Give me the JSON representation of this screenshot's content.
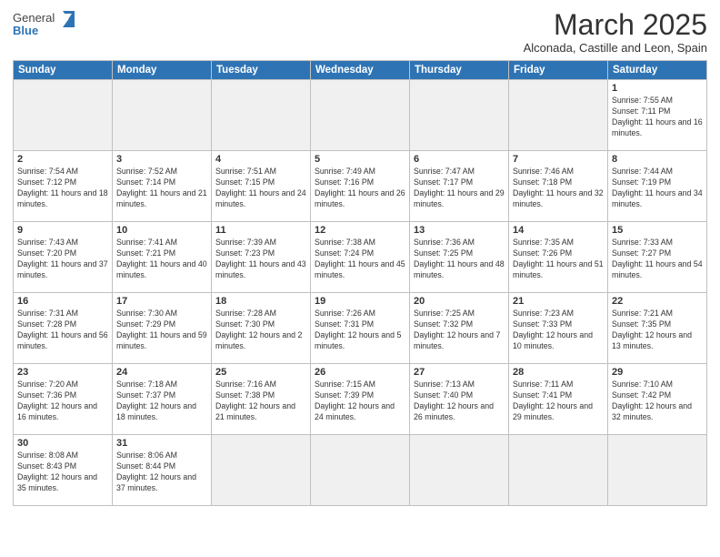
{
  "header": {
    "logo_general": "General",
    "logo_blue": "Blue",
    "month_title": "March 2025",
    "location": "Alconada, Castille and Leon, Spain"
  },
  "days_of_week": [
    "Sunday",
    "Monday",
    "Tuesday",
    "Wednesday",
    "Thursday",
    "Friday",
    "Saturday"
  ],
  "weeks": [
    [
      {
        "day": "",
        "empty": true
      },
      {
        "day": "",
        "empty": true
      },
      {
        "day": "",
        "empty": true
      },
      {
        "day": "",
        "empty": true
      },
      {
        "day": "",
        "empty": true
      },
      {
        "day": "",
        "empty": true
      },
      {
        "day": "1",
        "sunrise": "7:55 AM",
        "sunset": "7:11 PM",
        "daylight": "11 hours and 16 minutes."
      }
    ],
    [
      {
        "day": "2",
        "sunrise": "7:54 AM",
        "sunset": "7:12 PM",
        "daylight": "11 hours and 18 minutes."
      },
      {
        "day": "3",
        "sunrise": "7:52 AM",
        "sunset": "7:14 PM",
        "daylight": "11 hours and 21 minutes."
      },
      {
        "day": "4",
        "sunrise": "7:51 AM",
        "sunset": "7:15 PM",
        "daylight": "11 hours and 24 minutes."
      },
      {
        "day": "5",
        "sunrise": "7:49 AM",
        "sunset": "7:16 PM",
        "daylight": "11 hours and 26 minutes."
      },
      {
        "day": "6",
        "sunrise": "7:47 AM",
        "sunset": "7:17 PM",
        "daylight": "11 hours and 29 minutes."
      },
      {
        "day": "7",
        "sunrise": "7:46 AM",
        "sunset": "7:18 PM",
        "daylight": "11 hours and 32 minutes."
      },
      {
        "day": "8",
        "sunrise": "7:44 AM",
        "sunset": "7:19 PM",
        "daylight": "11 hours and 34 minutes."
      }
    ],
    [
      {
        "day": "9",
        "sunrise": "7:43 AM",
        "sunset": "7:20 PM",
        "daylight": "11 hours and 37 minutes."
      },
      {
        "day": "10",
        "sunrise": "7:41 AM",
        "sunset": "7:21 PM",
        "daylight": "11 hours and 40 minutes."
      },
      {
        "day": "11",
        "sunrise": "7:39 AM",
        "sunset": "7:23 PM",
        "daylight": "11 hours and 43 minutes."
      },
      {
        "day": "12",
        "sunrise": "7:38 AM",
        "sunset": "7:24 PM",
        "daylight": "11 hours and 45 minutes."
      },
      {
        "day": "13",
        "sunrise": "7:36 AM",
        "sunset": "7:25 PM",
        "daylight": "11 hours and 48 minutes."
      },
      {
        "day": "14",
        "sunrise": "7:35 AM",
        "sunset": "7:26 PM",
        "daylight": "11 hours and 51 minutes."
      },
      {
        "day": "15",
        "sunrise": "7:33 AM",
        "sunset": "7:27 PM",
        "daylight": "11 hours and 54 minutes."
      }
    ],
    [
      {
        "day": "16",
        "sunrise": "7:31 AM",
        "sunset": "7:28 PM",
        "daylight": "11 hours and 56 minutes."
      },
      {
        "day": "17",
        "sunrise": "7:30 AM",
        "sunset": "7:29 PM",
        "daylight": "11 hours and 59 minutes."
      },
      {
        "day": "18",
        "sunrise": "7:28 AM",
        "sunset": "7:30 PM",
        "daylight": "12 hours and 2 minutes."
      },
      {
        "day": "19",
        "sunrise": "7:26 AM",
        "sunset": "7:31 PM",
        "daylight": "12 hours and 5 minutes."
      },
      {
        "day": "20",
        "sunrise": "7:25 AM",
        "sunset": "7:32 PM",
        "daylight": "12 hours and 7 minutes."
      },
      {
        "day": "21",
        "sunrise": "7:23 AM",
        "sunset": "7:33 PM",
        "daylight": "12 hours and 10 minutes."
      },
      {
        "day": "22",
        "sunrise": "7:21 AM",
        "sunset": "7:35 PM",
        "daylight": "12 hours and 13 minutes."
      }
    ],
    [
      {
        "day": "23",
        "sunrise": "7:20 AM",
        "sunset": "7:36 PM",
        "daylight": "12 hours and 16 minutes."
      },
      {
        "day": "24",
        "sunrise": "7:18 AM",
        "sunset": "7:37 PM",
        "daylight": "12 hours and 18 minutes."
      },
      {
        "day": "25",
        "sunrise": "7:16 AM",
        "sunset": "7:38 PM",
        "daylight": "12 hours and 21 minutes."
      },
      {
        "day": "26",
        "sunrise": "7:15 AM",
        "sunset": "7:39 PM",
        "daylight": "12 hours and 24 minutes."
      },
      {
        "day": "27",
        "sunrise": "7:13 AM",
        "sunset": "7:40 PM",
        "daylight": "12 hours and 26 minutes."
      },
      {
        "day": "28",
        "sunrise": "7:11 AM",
        "sunset": "7:41 PM",
        "daylight": "12 hours and 29 minutes."
      },
      {
        "day": "29",
        "sunrise": "7:10 AM",
        "sunset": "7:42 PM",
        "daylight": "12 hours and 32 minutes."
      }
    ],
    [
      {
        "day": "30",
        "sunrise": "8:08 AM",
        "sunset": "8:43 PM",
        "daylight": "12 hours and 35 minutes."
      },
      {
        "day": "31",
        "sunrise": "8:06 AM",
        "sunset": "8:44 PM",
        "daylight": "12 hours and 37 minutes."
      },
      {
        "day": "",
        "empty": true
      },
      {
        "day": "",
        "empty": true
      },
      {
        "day": "",
        "empty": true
      },
      {
        "day": "",
        "empty": true
      },
      {
        "day": "",
        "empty": true
      }
    ]
  ],
  "labels": {
    "sunrise": "Sunrise:",
    "sunset": "Sunset:",
    "daylight": "Daylight:"
  }
}
